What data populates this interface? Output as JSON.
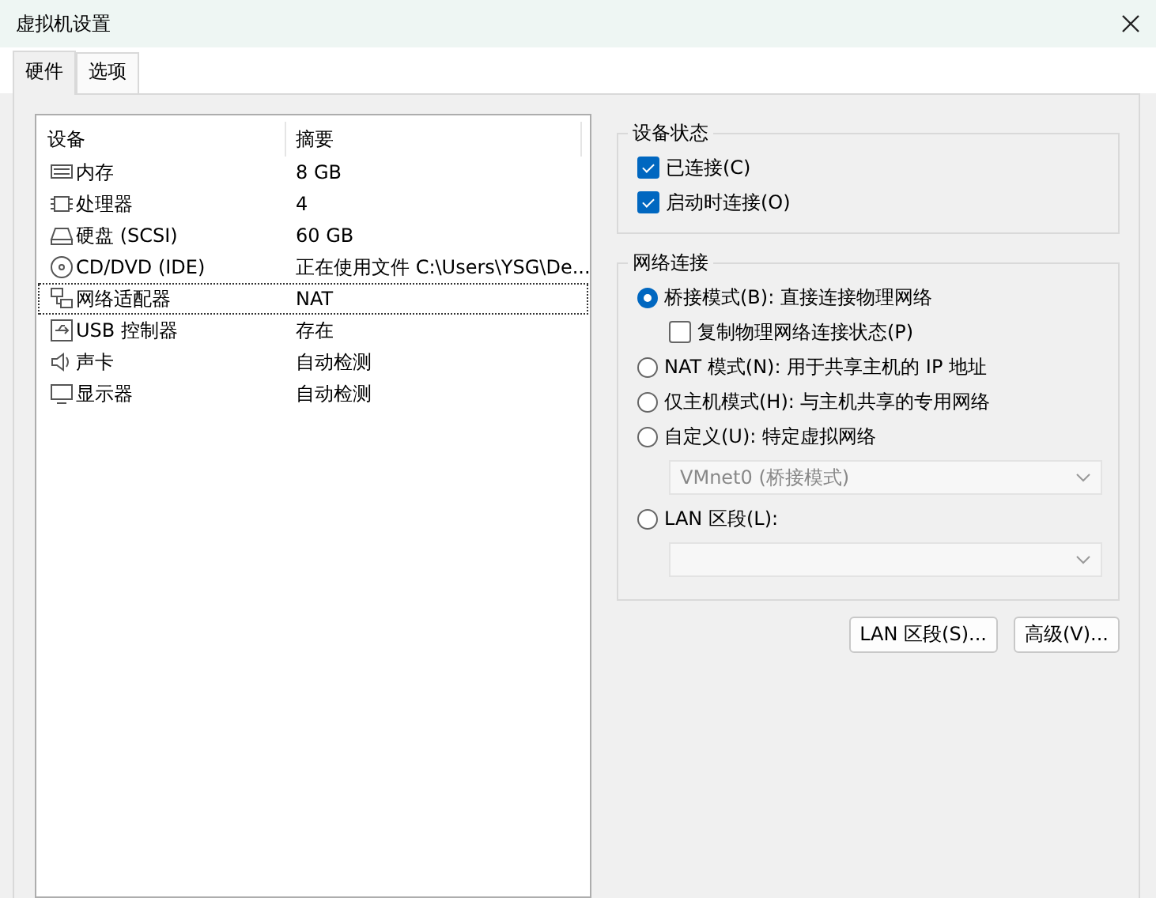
{
  "window": {
    "title": "虚拟机设置"
  },
  "tabs": [
    {
      "label": "硬件",
      "selected": true
    },
    {
      "label": "选项",
      "selected": false
    }
  ],
  "devices": {
    "columns": [
      "设备",
      "摘要"
    ],
    "rows": [
      {
        "kind": "memory",
        "device": "内存",
        "summary": "8 GB",
        "selected": false
      },
      {
        "kind": "cpu",
        "device": "处理器",
        "summary": "4",
        "selected": false
      },
      {
        "kind": "disk",
        "device": "硬盘 (SCSI)",
        "summary": "60 GB",
        "selected": false
      },
      {
        "kind": "cd",
        "device": "CD/DVD (IDE)",
        "summary": "正在使用文件 C:\\Users\\YSG\\De...",
        "selected": false
      },
      {
        "kind": "network",
        "device": "网络适配器",
        "summary": "NAT",
        "selected": true
      },
      {
        "kind": "usb",
        "device": "USB 控制器",
        "summary": "存在",
        "selected": false
      },
      {
        "kind": "sound",
        "device": "声卡",
        "summary": "自动检测",
        "selected": false
      },
      {
        "kind": "display",
        "device": "显示器",
        "summary": "自动检测",
        "selected": false
      }
    ]
  },
  "device_status": {
    "title": "设备状态",
    "options": [
      {
        "label": "已连接(C)",
        "checked": true
      },
      {
        "label": "启动时连接(O)",
        "checked": true
      }
    ]
  },
  "network_connection": {
    "title": "网络连接",
    "items": [
      {
        "kind": "radio",
        "label": "桥接模式(B): 直接连接物理网络",
        "selected": true
      },
      {
        "kind": "checkbox",
        "label": "复制物理网络连接状态(P)",
        "checked": false
      },
      {
        "kind": "radio",
        "label": "NAT 模式(N): 用于共享主机的 IP 地址",
        "selected": false
      },
      {
        "kind": "radio",
        "label": "仅主机模式(H): 与主机共享的专用网络",
        "selected": false
      },
      {
        "kind": "radio",
        "label": "自定义(U): 特定虚拟网络",
        "selected": false
      },
      {
        "kind": "dropdown",
        "value": "VMnet0 (桥接模式)",
        "disabled": true
      },
      {
        "kind": "radio",
        "label": "LAN 区段(L):",
        "selected": false
      },
      {
        "kind": "dropdown",
        "value": "",
        "disabled": true
      }
    ]
  },
  "buttons": [
    "LAN 区段(S)...",
    "高级(V)..."
  ]
}
